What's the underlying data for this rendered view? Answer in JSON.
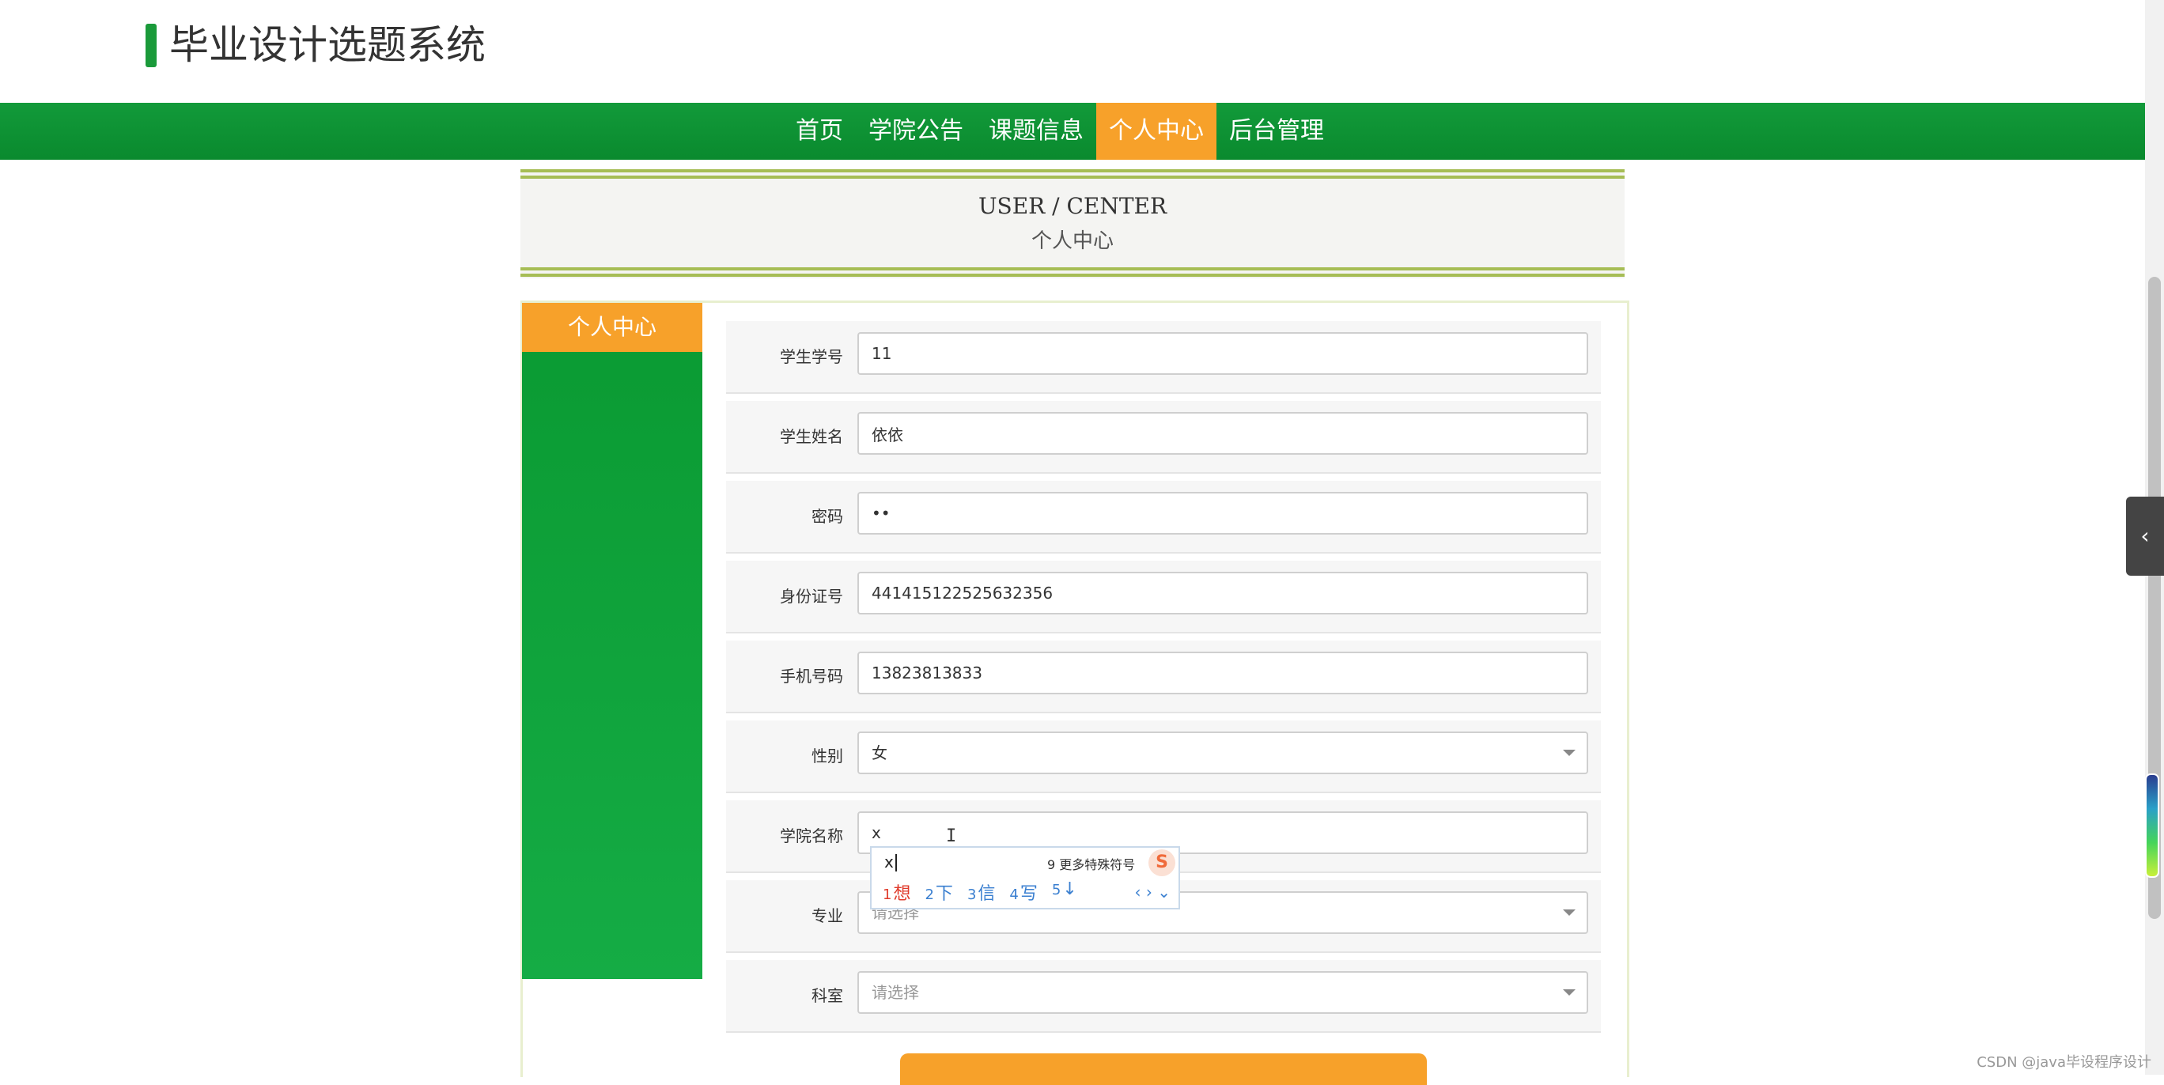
{
  "site": {
    "title": "毕业设计选题系统"
  },
  "nav": {
    "items": [
      {
        "label": "首页"
      },
      {
        "label": "学院公告"
      },
      {
        "label": "课题信息"
      },
      {
        "label": "个人中心"
      },
      {
        "label": "后台管理"
      }
    ],
    "active": "个人中心"
  },
  "banner": {
    "en": "USER / CENTER",
    "cn": "个人中心"
  },
  "sidebar": {
    "title": "个人中心"
  },
  "form": {
    "student_id": {
      "label": "学生学号",
      "value": "11"
    },
    "student_name": {
      "label": "学生姓名",
      "value": "依依"
    },
    "password": {
      "label": "密码",
      "value": "••"
    },
    "id_card": {
      "label": "身份证号",
      "value": "441415122525632356"
    },
    "phone": {
      "label": "手机号码",
      "value": "13823813833"
    },
    "gender": {
      "label": "性别",
      "value": "女"
    },
    "college": {
      "label": "学院名称",
      "value": "x"
    },
    "major": {
      "label": "专业",
      "placeholder": "请选择"
    },
    "department": {
      "label": "科室",
      "placeholder": "请选择"
    }
  },
  "ime": {
    "input": "x",
    "more": "9 更多特殊符号",
    "candidates": [
      {
        "num": "1",
        "text": "想"
      },
      {
        "num": "2",
        "text": "下"
      },
      {
        "num": "3",
        "text": "信"
      },
      {
        "num": "4",
        "text": "写"
      },
      {
        "num": "5",
        "text": "↓"
      }
    ],
    "nav": "‹ › ⌄",
    "logo": "S"
  },
  "side_tab": {
    "icon": "‹"
  },
  "watermark": "CSDN @java毕设程序设计",
  "colors": {
    "green": "#0a9a32",
    "orange": "#f7a12a",
    "olive": "#a6bd55"
  }
}
